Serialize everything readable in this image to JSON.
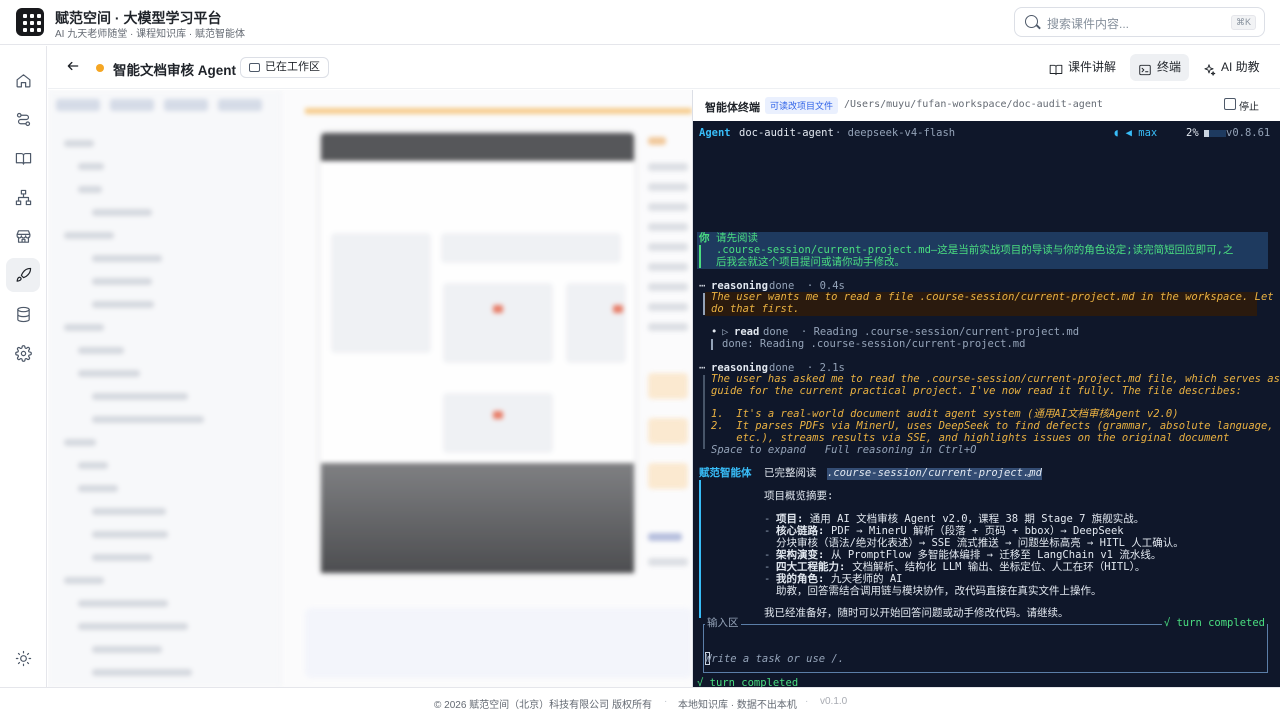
{
  "app": {
    "title": "赋范空间 · 大模型学习平台",
    "subtitle": "AI 九天老师随堂 · 课程知识库 · 赋范智能体"
  },
  "search": {
    "placeholder": "搜索课件内容...",
    "shortcut": "⌘K"
  },
  "sidebar": {
    "items": [
      {
        "icon": "home-icon"
      },
      {
        "icon": "workflow-icon"
      },
      {
        "icon": "book-icon"
      },
      {
        "icon": "hierarchy-icon"
      },
      {
        "icon": "store-icon"
      },
      {
        "icon": "rocket-icon",
        "active": true
      },
      {
        "icon": "database-icon"
      },
      {
        "icon": "gear-icon"
      }
    ],
    "theme_icon": "sun-icon"
  },
  "subheader": {
    "title": "智能文档审核 Agent",
    "workspace_badge": "已在工作区",
    "buttons": {
      "lecture": "课件讲解",
      "terminal": "终端",
      "assistant": "AI 助教"
    }
  },
  "terminal_panel": {
    "title": "智能体终端",
    "tag": "可读改项目文件",
    "path": "/Users/muyu/fufan-workspace/doc-audit-agent",
    "stop_label": "停止"
  },
  "terminal": {
    "status": {
      "agent": "Agent",
      "project": "doc-audit-agent",
      "model": "· deepseek-v4-flash",
      "mode": "◖ ◀ max",
      "percent": "2%",
      "version": "v0.8.61"
    },
    "user_label": "你",
    "user_line1": "请先阅读",
    "user_line2": ".course-session/current-project.md—这是当前实战项目的导读与你的角色设定;读完简短回应即可,之",
    "user_line3": "后我会就这个项目提问或请你动手修改。",
    "reason1_head": "reasoning",
    "reason1_meta": "done  · 0.4s",
    "reason1_line1": "The user wants me to read a file .course-session/current-project.md in the workspace. Let me",
    "reason1_line2": "do that first.",
    "tool_name": "read",
    "tool_meta": "done  · Reading .course-session/current-project.md",
    "tool_result": "done: Reading .course-session/current-project.md",
    "reason2_head": "reasoning",
    "reason2_meta": "done  · 2.1s",
    "reason2_line1": "The user has asked me to read the .course-session/current-project.md file, which serves as a",
    "reason2_line2": "guide for the current practical project. I've now read it fully. The file describes:",
    "reason2_item1": "1.  It's a real-world document audit agent system (通用AI文档审核Agent v2.0)",
    "reason2_item2": "2.  It parses PDFs via MinerU, uses DeepSeek to find defects (grammar, absolute language,",
    "reason2_item2b": "    etc.), streams results via SSE, and highlights issues on the original document",
    "reason2_hint": "Space to expand   Full reasoning in Ctrl+O",
    "agent_label": "赋范智能体",
    "agent_line1_a": "已完整阅读 ",
    "agent_line1_b": ".course-session/current-project.md",
    "agent_line1_c": "。",
    "summary_title": "项目概览摘要:",
    "summary": [
      {
        "key": "项目:",
        "val": "通用 AI 文档审核 Agent v2.0，课程 38 期 Stage 7 旗舰实战。"
      },
      {
        "key": "核心链路:",
        "val": "PDF → MinerU 解析（段落 + 页码 + bbox）→ DeepSeek"
      },
      {
        "key": "",
        "val": "分块审核（语法/绝对化表述）→ SSE 流式推送 → 问题坐标高亮 → HITL 人工确认。"
      },
      {
        "key": "架构演变:",
        "val": "从 PromptFlow 多智能体编排 → 迁移至 LangChain v1 流水线。"
      },
      {
        "key": "四大工程能力:",
        "val": "文档解析、结构化 LLM 输出、坐标定位、人工在环（HITL）。"
      },
      {
        "key": "我的角色:",
        "val": "九天老师的 AI"
      },
      {
        "key": "",
        "val": "助教，回答需结合调用链与模块协作，改代码直接在真实文件上操作。"
      }
    ],
    "closing": "我已经准备好，随时可以开始回答问题或动手修改代码。请继续。",
    "input_label": "输入区",
    "input_status": "√ turn completed",
    "input_placeholder": "Write a task or use /.",
    "final_status": "√ turn completed"
  },
  "footer": {
    "copyright": "© 2026 赋范空间（北京）科技有限公司 版权所有",
    "sep": "·",
    "note": "本地知识库 · 数据不出本机",
    "version": "v0.1.0"
  },
  "colors": {
    "accent_dot": "#f5a623",
    "terminal_bg": "#0f172a",
    "cyan": "#38bdf8",
    "green": "#4ade80",
    "reasoning": "#e9b142"
  }
}
